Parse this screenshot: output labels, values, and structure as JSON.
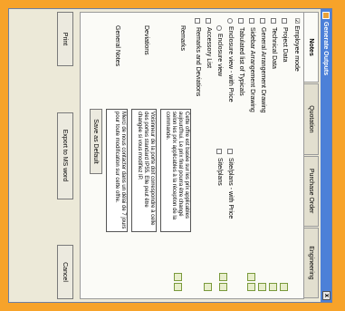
{
  "window": {
    "title": "Generate Outputs",
    "close_label": "x"
  },
  "tabs": [
    {
      "label": "Notes"
    },
    {
      "label": "Quotation"
    },
    {
      "label": "Purchase Order"
    },
    {
      "label": "Engineering"
    }
  ],
  "notes": {
    "heading": "Employee mode",
    "checkboxes": [
      {
        "label": "Project Data",
        "checked": false
      },
      {
        "label": "Technical Data",
        "checked": false
      },
      {
        "label": "General Arrangement Drawing",
        "checked": false
      },
      {
        "label": "Sidebar Arrangement Drawing",
        "checked": false
      },
      {
        "label": "Tabulated list of Typicals",
        "checked": false
      }
    ],
    "enclosure_with_price": "Enclosure view - with Price",
    "siteplan_with_price": "Site/plans - with Price",
    "enclosure_view": "Enclosure view",
    "siteplans": "Site/plans",
    "accessory_list": "Accessory List",
    "remarks_and_deviations": "Remarks and Deviations",
    "remarks_label": "Remarks",
    "remarks_text": "Cette offre est basée sur les prix applicables aujourd'hui. Le prix final pourra être changé selon les prix applicables à la réception de la commande.",
    "deviations_label": "Deviations",
    "deviations_text": "Voisinneur de la porte doit correspondre à celle des portes standard IP55. Elle peut être changée si vous modifiez IP.",
    "general_notes_label": "General Notes",
    "general_notes_text": "Merci de nous contacter dans un délai de 7 jours pour toute modification sur cette offre.",
    "save_default_label": "Save as Default"
  },
  "footer": {
    "print_label": "Print",
    "export_label": "Export to MS word",
    "cancel_label": "Cancel"
  }
}
